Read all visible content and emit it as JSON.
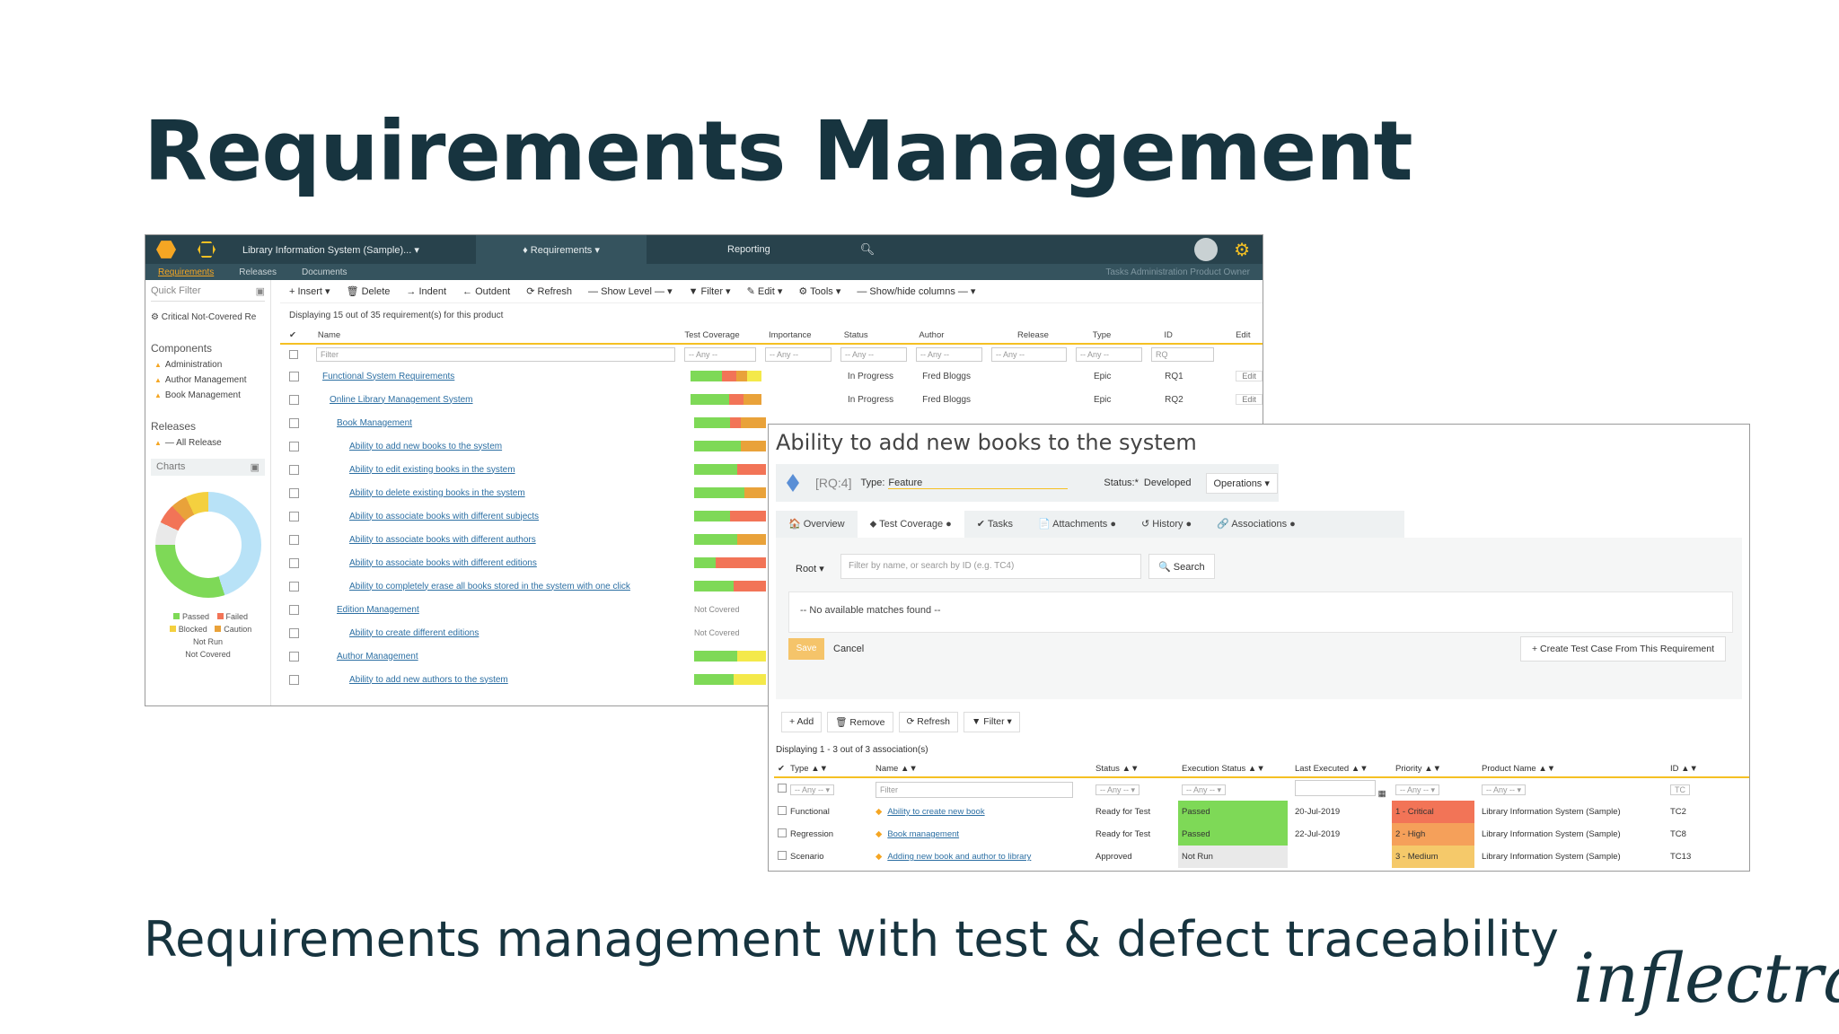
{
  "slide": {
    "title": "Requirements Management",
    "subtitle": "Requirements management with test & defect traceability",
    "logo_text": "inflectra",
    "logo_mark": "®"
  },
  "colors": {
    "brand_dark": "#17343f",
    "topbar": "#28424c",
    "accent": "#f5a623",
    "passed": "#7ed957",
    "failed": "#f27457",
    "caution": "#f4d03f",
    "not_run": "#e9e9e9"
  },
  "shot1": {
    "topbar": {
      "project": "Library Information System (Sample)... ▾",
      "requirements": "♦ Requirements ▾",
      "reporting": "Reporting"
    },
    "subtabs": [
      "Requirements",
      "Releases",
      "Documents"
    ],
    "subtabs_right": "Tasks  Administration  Product Owner",
    "sidebar": {
      "quick_filter": "Quick Filter",
      "critical": "Critical Not-Covered Re",
      "components_heading": "Components",
      "components": [
        "Administration",
        "Author Management",
        "Book Management"
      ],
      "releases_heading": "Releases",
      "release_item": "— All Release",
      "charts": "Charts",
      "legend": [
        "Passed",
        "Failed",
        "Blocked",
        "Caution",
        "Not Run",
        "Not Covered"
      ]
    },
    "toolbar": [
      "+ Insert ▾",
      "🗑 Delete",
      "→ Indent",
      "← Outdent",
      "⟳ Refresh",
      "— Show Level — ▾",
      "▼ Filter ▾",
      "✎ Edit ▾",
      "⚙ Tools ▾",
      "— Show/hide columns — ▾"
    ],
    "display_text": "Displaying 15 out of 35 requirement(s) for this product",
    "columns": [
      "Name",
      "Test Coverage",
      "Importance",
      "Status",
      "Author",
      "Release",
      "Type",
      "ID",
      "Edit"
    ],
    "filter": {
      "name": "Filter",
      "any": "-- Any --",
      "id": "RQ"
    },
    "rows": [
      {
        "name": "Functional System Requirements",
        "status": "In Progress",
        "author": "Fred Bloggs",
        "type": "Epic",
        "id": "RQ1",
        "edit": "Edit"
      },
      {
        "name": "Online Library Management System",
        "status": "In Progress",
        "author": "Fred Bloggs",
        "type": "Epic",
        "id": "RQ2",
        "edit": "Edit"
      },
      {
        "name": "Book Management"
      },
      {
        "name": "Ability to add new books to the system"
      },
      {
        "name": "Ability to edit existing books in the system"
      },
      {
        "name": "Ability to delete existing books in the system"
      },
      {
        "name": "Ability to associate books with different subjects"
      },
      {
        "name": "Ability to associate books with different authors"
      },
      {
        "name": "Ability to associate books with different editions"
      },
      {
        "name": "Ability to completely erase all books stored in the system with one click"
      },
      {
        "name": "Edition Management",
        "coverage_text": "Not Covered"
      },
      {
        "name": "Ability to create different editions",
        "coverage_text": "Not Covered"
      },
      {
        "name": "Author Management"
      },
      {
        "name": "Ability to add new authors to the system"
      }
    ],
    "coverage": [
      [
        0.45,
        0.2,
        0.15,
        0.2
      ],
      [
        0.55,
        0.2,
        0.25,
        0
      ],
      [
        0.5,
        0.15,
        0.35,
        0
      ],
      [
        0.65,
        0,
        0.35,
        0
      ],
      [
        0.6,
        0.4,
        0,
        0
      ],
      [
        0.7,
        0,
        0.3,
        0
      ],
      [
        0.5,
        0.5,
        0,
        0
      ],
      [
        0.6,
        0,
        0.4,
        0
      ],
      [
        0.3,
        0.7,
        0,
        0
      ],
      [
        0.55,
        0.45,
        0,
        0
      ],
      [
        0,
        0,
        0,
        0
      ],
      [
        0,
        0,
        0,
        0
      ],
      [
        0.6,
        0,
        0,
        0.4
      ],
      [
        0.55,
        0,
        0,
        0.45
      ]
    ]
  },
  "shot2": {
    "title": "Ability to add new books to the system",
    "rq_id": "[RQ:4]",
    "type_label": "Type:",
    "type_value": "Feature",
    "status_label": "Status:*",
    "status_value": "Developed",
    "operations": "Operations ▾",
    "tabs": [
      "🏠 Overview",
      "⬥ Test Coverage ●",
      "✔ Tasks",
      "📄 Attachments ●",
      "↺ History ●",
      "🔗 Associations ●"
    ],
    "root": "Root ▾",
    "filter_placeholder": "Filter by name, or search by ID (e.g. TC4)",
    "search": "🔍 Search",
    "no_matches": "-- No available matches found --",
    "save": "Save",
    "cancel": "Cancel",
    "create": "+ Create Test Case From This Requirement",
    "toolbar": [
      "+ Add",
      "🗑 Remove",
      "⟳ Refresh",
      "▼ Filter ▾"
    ],
    "display_text": "Displaying 1 - 3 out of 3 association(s)",
    "columns": [
      "Type ▲▼",
      "Name ▲▼",
      "Status ▲▼",
      "Execution Status ▲▼",
      "Last Executed ▲▼",
      "Priority ▲▼",
      "Product Name ▲▼",
      "ID ▲▼"
    ],
    "filter": {
      "any": "-- Any -- ▾",
      "name": "Filter",
      "id": "TC"
    },
    "rows": [
      {
        "type": "Functional",
        "name": "Ability to create new book",
        "status": "Ready for Test",
        "exec": "Passed",
        "exec_color": "#7ed957",
        "last": "20-Jul-2019",
        "priority": "1 - Critical",
        "priority_color": "#f27457",
        "product": "Library Information System (Sample)",
        "id": "TC2"
      },
      {
        "type": "Regression",
        "name": "Book management",
        "status": "Ready for Test",
        "exec": "Passed",
        "exec_color": "#7ed957",
        "last": "22-Jul-2019",
        "priority": "2 - High",
        "priority_color": "#f5a05a",
        "product": "Library Information System (Sample)",
        "id": "TC8"
      },
      {
        "type": "Scenario",
        "name": "Adding new book and author to library",
        "status": "Approved",
        "exec": "Not Run",
        "exec_color": "#e9e9e9",
        "last": "",
        "priority": "3 - Medium",
        "priority_color": "#f5c96a",
        "product": "Library Information System (Sample)",
        "id": "TC13"
      }
    ]
  }
}
